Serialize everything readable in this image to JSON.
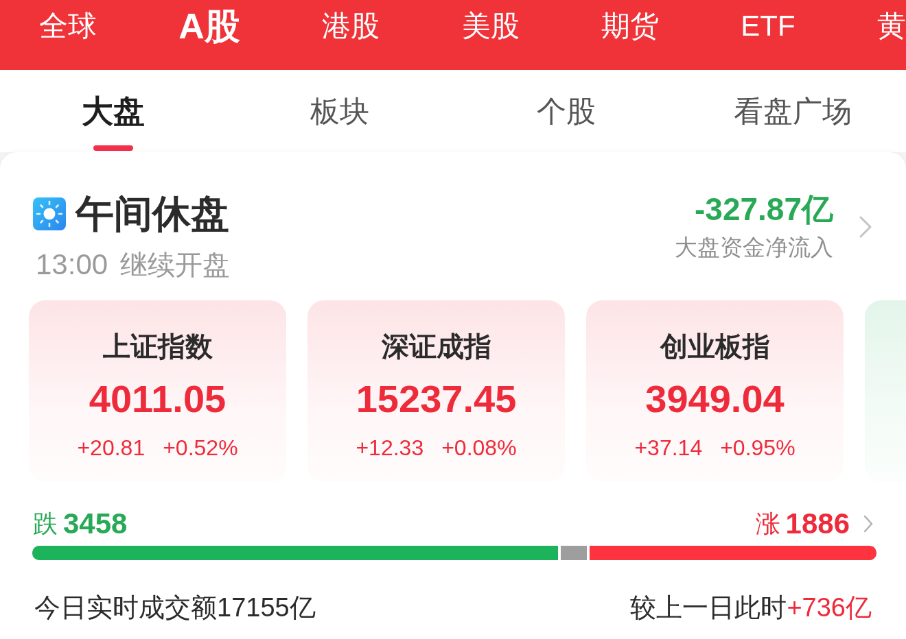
{
  "market_tabs": [
    {
      "label": "全球",
      "selected": false
    },
    {
      "label": "A股",
      "selected": true
    },
    {
      "label": "港股",
      "selected": false
    },
    {
      "label": "美股",
      "selected": false
    },
    {
      "label": "期货",
      "selected": false
    },
    {
      "label": "ETF",
      "selected": false
    },
    {
      "label": "黄",
      "selected": false
    }
  ],
  "section_tabs": [
    {
      "label": "大盘",
      "selected": true
    },
    {
      "label": "板块",
      "selected": false
    },
    {
      "label": "个股",
      "selected": false
    },
    {
      "label": "看盘广场",
      "selected": false
    }
  ],
  "session": {
    "title": "午间休盘",
    "resume_time": "13:00",
    "resume_label": "继续开盘"
  },
  "fund_flow": {
    "value": "-327.87亿",
    "label": "大盘资金净流入",
    "rising": false
  },
  "index_cards": [
    {
      "name": "上证指数",
      "value": "4011.05",
      "change": "+20.81",
      "change_pct": "+0.52%",
      "rising": true
    },
    {
      "name": "深证成指",
      "value": "15237.45",
      "change": "+12.33",
      "change_pct": "+0.08%",
      "rising": true
    },
    {
      "name": "创业板指",
      "value": "3949.04",
      "change": "+37.14",
      "change_pct": "+0.95%",
      "rising": true
    },
    {
      "rising": false
    }
  ],
  "breadth": {
    "down_label": "跌",
    "down_count": "3458",
    "up_label": "涨",
    "up_count": "1886",
    "fills": [
      {
        "kind": "decline",
        "level": 0.626
      },
      {
        "kind": "advance",
        "level": 0.343
      }
    ]
  },
  "turnover": {
    "label": "今日实时成交额17155亿",
    "compare_label": "较上一日此时",
    "compare_value": "+736亿",
    "compare_rising": true
  }
}
